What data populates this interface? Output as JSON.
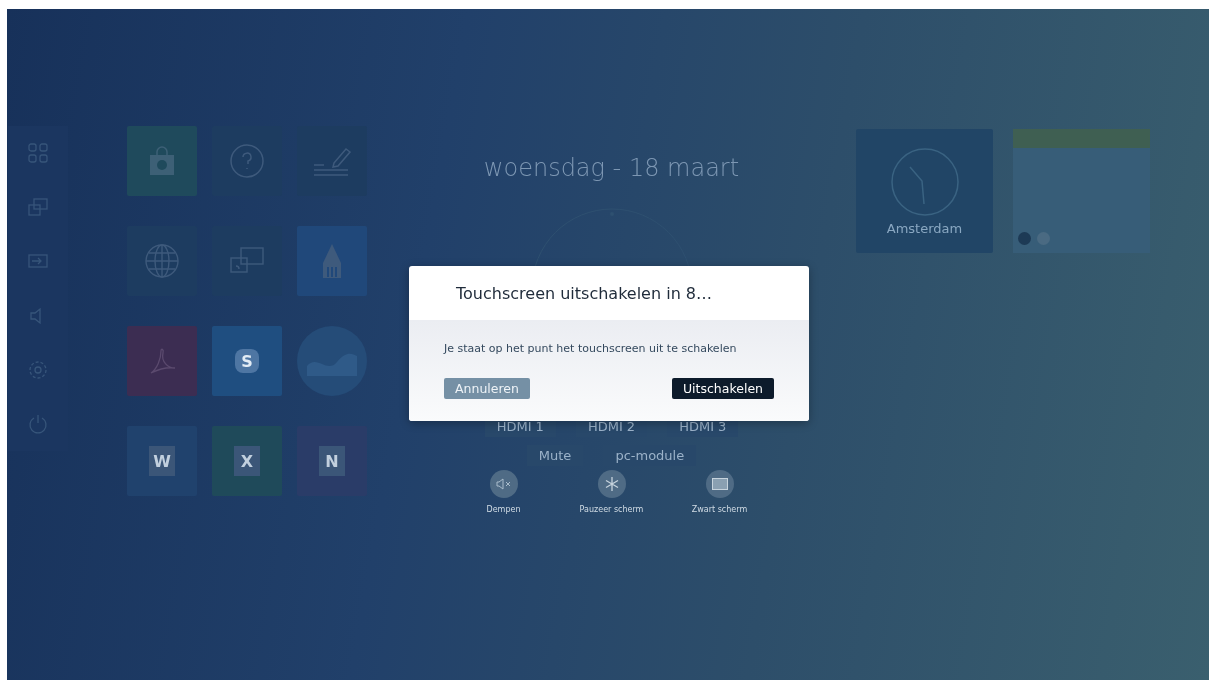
{
  "apps": [
    {
      "kind": "store"
    },
    {
      "kind": "help"
    },
    {
      "kind": "whiteboard"
    },
    {
      "kind": "browser"
    },
    {
      "kind": "cast"
    },
    {
      "kind": "pencil"
    },
    {
      "kind": "pdf"
    },
    {
      "kind": "skype",
      "glyph": "S"
    },
    {
      "kind": "earth"
    },
    {
      "kind": "word",
      "glyph": "W"
    },
    {
      "kind": "excel",
      "glyph": "X"
    },
    {
      "kind": "onenote",
      "glyph": "N"
    }
  ],
  "date": "woensdag - 18 maart",
  "sources": [
    [
      "HDMI 1",
      "HDMI 2",
      "HDMI 3"
    ],
    [
      "Mute",
      "pc-module"
    ]
  ],
  "actions": [
    {
      "kind": "mute",
      "label": "Dempen"
    },
    {
      "kind": "freeze",
      "label": "Pauzeer scherm"
    },
    {
      "kind": "blank",
      "label": "Zwart scherm"
    }
  ],
  "clock_widget": {
    "city": "Amsterdam"
  },
  "dialog": {
    "title": "Touchscreen uitschakelen in 8…",
    "message": "Je staat op het punt het touchscreen uit te schakelen",
    "buttons": [
      {
        "kind": "secondary",
        "label": "Annuleren"
      },
      {
        "kind": "primary",
        "label": "Uitschakelen"
      }
    ]
  }
}
